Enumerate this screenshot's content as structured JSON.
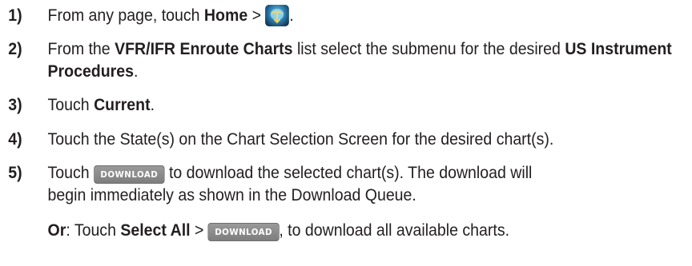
{
  "steps": [
    {
      "num": "1)",
      "pre": "From any page, touch ",
      "bold1": "Home",
      "mid": " > ",
      "icon": "charts-globe-icon",
      "post": "."
    },
    {
      "num": "2)",
      "pre": "From the ",
      "bold1": "VFR/IFR Enroute Charts",
      "mid": " list select the submenu for the desired ",
      "bold2": "US Instrument Procedures",
      "post": "."
    },
    {
      "num": "3)",
      "pre": "Touch ",
      "bold1": "Current",
      "post": "."
    },
    {
      "num": "4)",
      "text": "Touch the State(s) on the Chart Selection Screen for the desired chart(s)."
    },
    {
      "num": "5)",
      "pre": "Touch ",
      "button": "DOWNLOAD",
      "post": " to download the selected chart(s). The download will",
      "line2": "begin immediately as shown in the Download Queue."
    }
  ],
  "or_line": {
    "label": "Or",
    "colon": ": Touch ",
    "bold": "Select All",
    "mid": " > ",
    "button": "DOWNLOAD",
    "post": ", to download all available charts."
  }
}
